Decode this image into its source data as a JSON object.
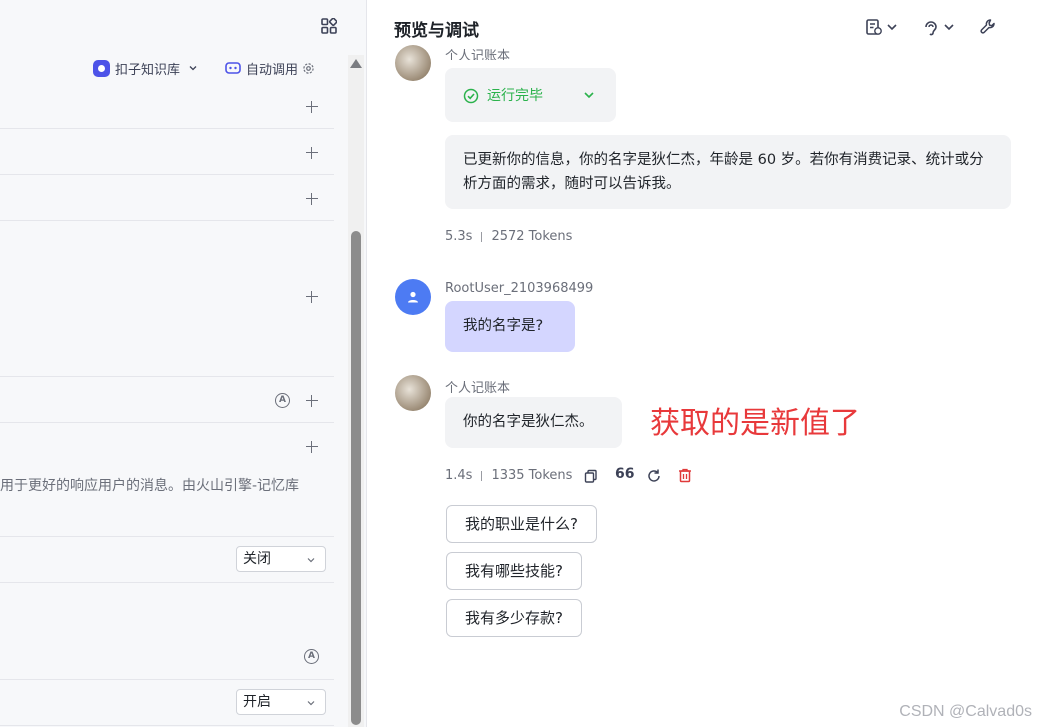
{
  "left": {
    "kb_label": "扣子知识库",
    "auto_label": "自动调用",
    "memory_desc": "用于更好的响应用户的消息。由火山引擎-记忆库",
    "a_icon_glyph": "A",
    "select_1": "关闭",
    "select_2": "开启"
  },
  "right": {
    "title": "预览与调试",
    "messages": {
      "bot_name": "个人记账本",
      "run_status": "运行完毕",
      "reply_1": "已更新你的信息，你的名字是狄仁杰，年龄是 60 岁。若你有消费记录、统计或分析方面的需求，随时可以告诉我。",
      "meta_1_time": "5.3s",
      "meta_1_tokens": "2572 Tokens",
      "user_name": "RootUser_2103968499",
      "user_msg": "我的名字是?",
      "bot_name_2": "个人记账本",
      "reply_2": "你的名字是狄仁杰。",
      "meta_2_time": "1.4s",
      "meta_2_tokens": "1335 Tokens",
      "quote_glyph": "66"
    },
    "suggestions": [
      "我的职业是什么?",
      "我有哪些技能?",
      "我有多少存款?"
    ],
    "annotation": "获取的是新值了"
  },
  "watermark": "CSDN @Calvad0s",
  "colors": {
    "accent": "#4d53e8",
    "success": "#2bb24c",
    "user_bubble": "#d4d6ff",
    "annotation": "#e8393b",
    "delete": "#e03a3a"
  }
}
